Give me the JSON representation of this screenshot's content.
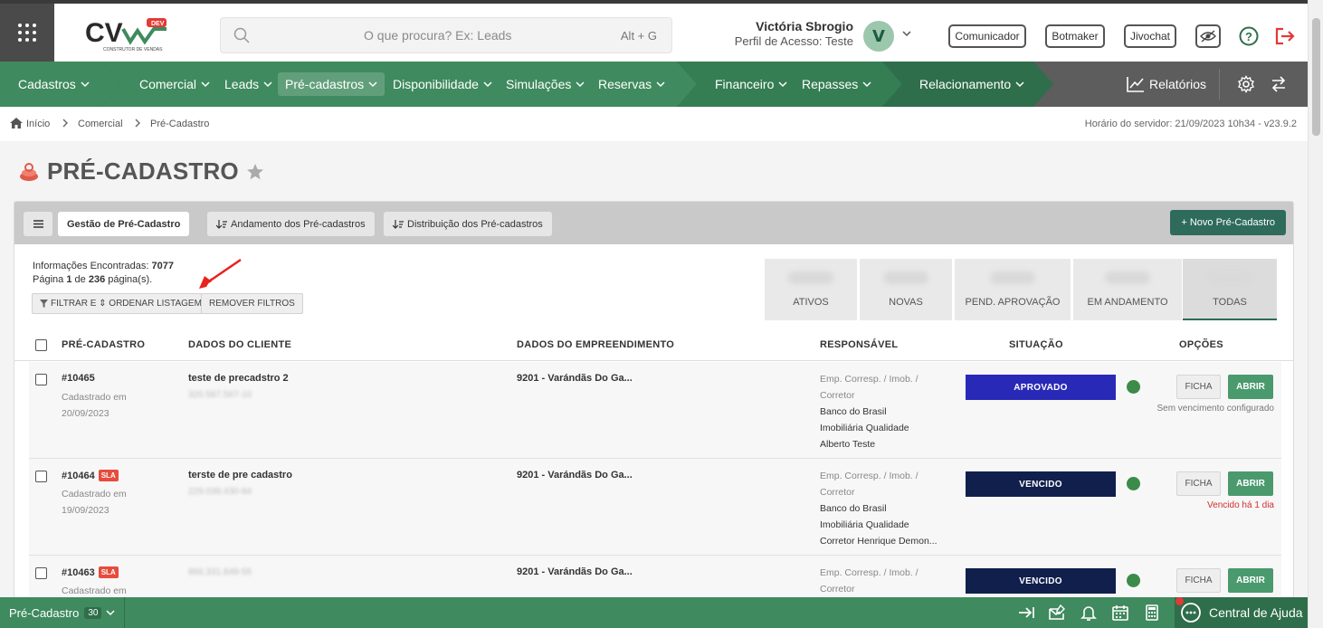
{
  "header": {
    "logo_text": "CV",
    "logo_badge": "DEV",
    "logo_sub": "CONSTRUTOR DE VENDAS",
    "search_placeholder": "O que procura? Ex: Leads",
    "search_shortcut": "Alt + G",
    "user_name": "Victória Sbrogio",
    "user_profile": "Perfil de Acesso: Teste",
    "avatar_letter": "V",
    "buttons": [
      "Comunicador",
      "Botmaker",
      "Jivochat"
    ]
  },
  "nav": {
    "items": [
      "Cadastros",
      "Comercial",
      "Leads",
      "Pré-cadastros",
      "Disponibilidade",
      "Simulações",
      "Reservas",
      "Financeiro",
      "Repasses",
      "Relacionamento"
    ],
    "relatorios": "Relatórios"
  },
  "breadcrumb": {
    "items": [
      "Início",
      "Comercial",
      "Pré-Cadastro"
    ],
    "server_time": "Horário do servidor: 21/09/2023 10h34 - v23.9.2"
  },
  "page": {
    "title": "PRÉ-CADASTRO"
  },
  "tabs": [
    "Gestão de Pré-Cadastro",
    "Andamento dos Pré-cadastros",
    "Distribuição dos Pré-cadastros"
  ],
  "new_button": "+ Novo Pré-Cadastro",
  "info": {
    "found_label": "Informações Encontradas:",
    "found_value": "7077",
    "page_label": "Página",
    "page_current": "1",
    "page_of": "de",
    "page_total": "236",
    "page_suffix": "página(s)."
  },
  "filters": {
    "filter_btn": "FILTRAR E ⇕ ORDENAR LISTAGEM",
    "remove_btn": "REMOVER FILTROS"
  },
  "stats": [
    "ATIVOS",
    "NOVAS",
    "PEND. APROVAÇÃO",
    "EM ANDAMENTO",
    "TODAS"
  ],
  "columns": [
    "PRÉ-CADASTRO",
    "DADOS DO CLIENTE",
    "DADOS DO EMPREENDIMENTO",
    "RESPONSÁVEL",
    "SITUAÇÃO",
    "OPÇÕES"
  ],
  "rows": [
    {
      "id": "#10465",
      "sla": "",
      "cad_label": "Cadastrado em",
      "date": "20/09/2023",
      "client": "teste de precadstro 2",
      "client_doc": "320.587.567-10",
      "emp": "9201 - Varándãs Do Ga...",
      "resp_type": "Emp. Corresp. / Imob. /",
      "resp_type2": "Corretor",
      "bank": "Banco do Brasil",
      "imob": "Imobiliária Qualidade",
      "corretor": "Alberto Teste",
      "status": "APROVADO",
      "status_color": "#2929b8",
      "ficha": "FICHA",
      "abrir": "ABRIR",
      "venc": "Sem vencimento configurado",
      "venc_color": "#777777"
    },
    {
      "id": "#10464",
      "sla": "SLA",
      "cad_label": "Cadastrado em",
      "date": "19/09/2023",
      "client": "terste de pre cadastro",
      "client_doc": "229.039.430-84",
      "emp": "9201 - Varándãs Do Ga...",
      "resp_type": "Emp. Corresp. / Imob. /",
      "resp_type2": "Corretor",
      "bank": "Banco do Brasil",
      "imob": "Imobiliária Qualidade",
      "corretor": "Corretor Henrique Demon...",
      "status": "VENCIDO",
      "status_color": "#101f4c",
      "ficha": "FICHA",
      "abrir": "ABRIR",
      "venc": "Vencido há 1 dia",
      "venc_color": "#d32f2f"
    },
    {
      "id": "#10463",
      "sla": "SLA",
      "cad_label": "Cadastrado em",
      "date": "",
      "client": "",
      "client_doc": "866.331.849-55",
      "emp": "9201 - Varándãs Do Ga...",
      "resp_type": "Emp. Corresp. / Imob. /",
      "resp_type2": "Corretor",
      "bank": "",
      "imob": "",
      "corretor": "",
      "status": "VENCIDO",
      "status_color": "#101f4c",
      "ficha": "FICHA",
      "abrir": "ABRIR",
      "venc": "",
      "venc_color": "#d32f2f"
    }
  ],
  "footer": {
    "module": "Pré-Cadastro",
    "count": "30",
    "help": "Central de Ajuda"
  },
  "colors": {
    "nav_green": "#3f8a5e",
    "nav_dark_green": "#2e6e4a",
    "new_btn": "#2e6b5b",
    "status_dot": "#3d8b4a"
  }
}
